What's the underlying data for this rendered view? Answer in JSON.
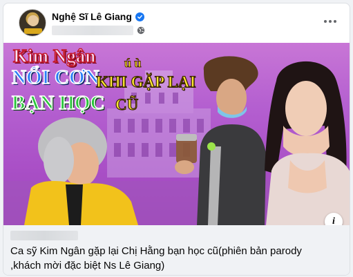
{
  "post": {
    "author_name": "Nghệ Sĩ Lê Giang",
    "verified": true,
    "more_icon": "more-horizontal-icon",
    "privacy_icon": "globe-icon"
  },
  "media": {
    "title_line1": "Kim Ngân",
    "title_line1_small": "ú ù",
    "title_line2": "NỔI CƠN",
    "title_line2_small": "KHI GẶP LẠI",
    "title_line3": "BẠN HỌC",
    "title_line3_small": "CŨ",
    "info_label": "i"
  },
  "link_preview": {
    "title": "Ca sỹ Kim Ngân gặp lại Chị Hằng bạn học cũ(phiên bản parody ,khách mời đặc biệt Ns Lê Giang)"
  },
  "colors": {
    "accent_blue": "#1877f2",
    "background": "#f0f2f5",
    "thumbnail_purple": "#b45fd0"
  }
}
